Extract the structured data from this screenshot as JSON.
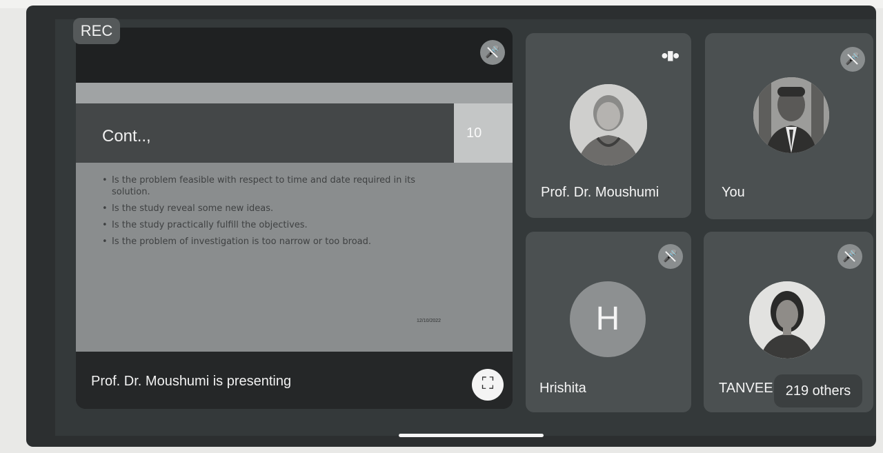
{
  "recording_badge": "REC",
  "presentation": {
    "slide_title": "Cont..,",
    "slide_number": "10",
    "bullets": [
      "Is the problem feasible with respect to time and date required in its solution.",
      "Is the study reveal some new ideas.",
      "Is the study practically fulfill the objectives.",
      "Is the problem of investigation is too narrow or too broad."
    ],
    "slide_date": "12/10/2022",
    "presenter_status": "Prof. Dr. Moushumi is presenting"
  },
  "participants": [
    {
      "name": "Prof. Dr. Moushumi",
      "state": "speaking"
    },
    {
      "name": "You",
      "state": "muted"
    },
    {
      "name": "Hrishita",
      "state": "muted",
      "initial": "H"
    },
    {
      "name": "TANVEE",
      "state": "muted"
    }
  ],
  "others_count": "219 others",
  "icons": {
    "mic_off": "mic-off-icon",
    "speaking": "audio-wave-icon",
    "fullscreen": "fullscreen-icon"
  },
  "colors": {
    "background": "#34393a",
    "tile": "#4b5051",
    "slide": "#8a8d8e"
  }
}
